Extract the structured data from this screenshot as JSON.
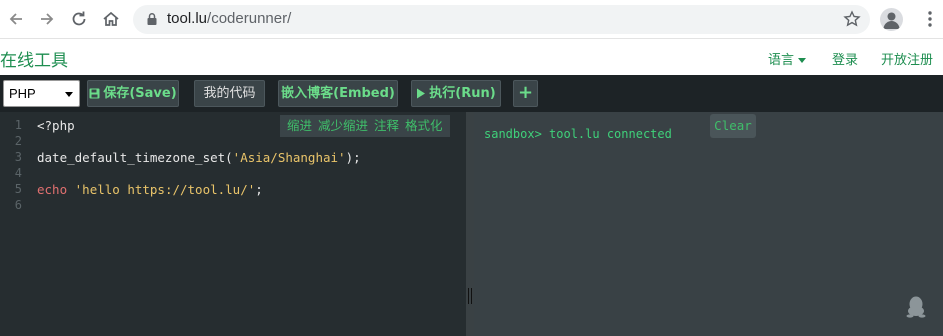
{
  "browser": {
    "url_host": "tool.lu",
    "url_path": "/coderunner/"
  },
  "site": {
    "title": "在线工具",
    "nav": {
      "language": "语言",
      "login": "登录",
      "register": "开放注册"
    }
  },
  "toolbar": {
    "language_selected": "PHP",
    "save_label": "保存(Save)",
    "my_code_label": "我的代码",
    "embed_label": "嵌入博客(Embed)",
    "run_label": "执行(Run)",
    "add_label": "+"
  },
  "editor": {
    "line_numbers": [
      "1",
      "2",
      "3",
      "4",
      "5",
      "6"
    ],
    "actions": {
      "indent": "缩进",
      "outdent": "减少缩进",
      "comment": "注释",
      "format": "格式化"
    },
    "lines": {
      "l1": "<?php",
      "l3_fn": "date_default_timezone_set(",
      "l3_str": "'Asia/Shanghai'",
      "l3_end": ");",
      "l5_kw": "echo",
      "l5_str": "'hello https://tool.lu/'",
      "l5_end": ";"
    }
  },
  "console": {
    "output": "sandbox> tool.lu connected",
    "clear_label": "Clear"
  },
  "colors": {
    "brand_green": "#1e8e50",
    "button_green": "#6bdc8a",
    "console_green": "#3fd17a",
    "editor_bg": "#262d30",
    "console_bg": "#394145",
    "toolbar_bg": "#1d2326"
  }
}
